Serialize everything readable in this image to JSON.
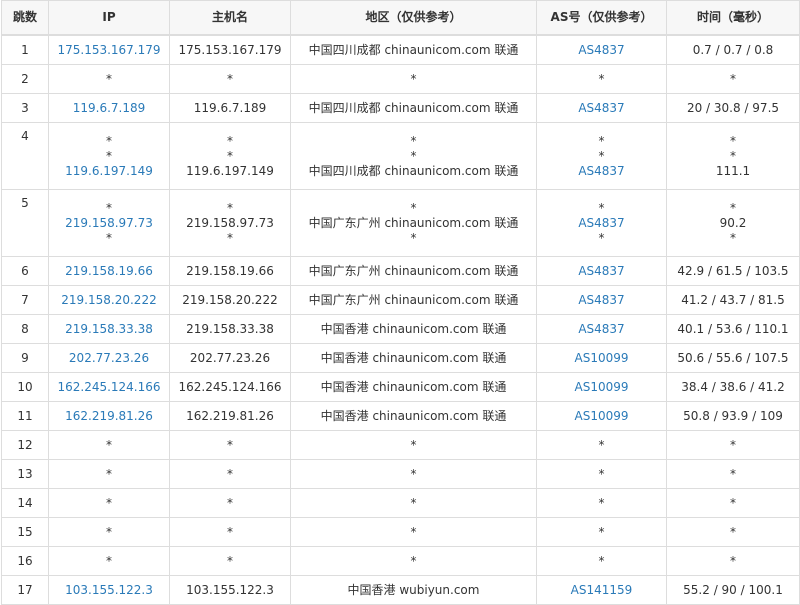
{
  "columns": [
    "跳数",
    "IP",
    "主机名",
    "地区（仅供参考）",
    "AS号（仅供参考）",
    "时间（毫秒）"
  ],
  "accent_link_color": "#2a7ab8",
  "rows": [
    {
      "hop": "1",
      "lines": [
        {
          "ip": "175.153.167.179",
          "host": "175.153.167.179",
          "region": "中国四川成都 chinaunicom.com 联通",
          "asn": "AS4837",
          "time": "0.7 / 0.7 / 0.8"
        }
      ]
    },
    {
      "hop": "2",
      "lines": [
        {
          "ip": "*",
          "host": "*",
          "region": "*",
          "asn": "*",
          "time": "*"
        }
      ]
    },
    {
      "hop": "3",
      "lines": [
        {
          "ip": "119.6.7.189",
          "host": "119.6.7.189",
          "region": "中国四川成都 chinaunicom.com 联通",
          "asn": "AS4837",
          "time": "20 / 30.8 / 97.5"
        }
      ]
    },
    {
      "hop": "4",
      "lines": [
        {
          "ip": "*",
          "host": "*",
          "region": "*",
          "asn": "*",
          "time": "*"
        },
        {
          "ip": "*",
          "host": "*",
          "region": "*",
          "asn": "*",
          "time": "*"
        },
        {
          "ip": "119.6.197.149",
          "host": "119.6.197.149",
          "region": "中国四川成都 chinaunicom.com 联通",
          "asn": "AS4837",
          "time": "111.1"
        }
      ]
    },
    {
      "hop": "5",
      "lines": [
        {
          "ip": "*",
          "host": "*",
          "region": "*",
          "asn": "*",
          "time": "*"
        },
        {
          "ip": "219.158.97.73",
          "host": "219.158.97.73",
          "region": "中国广东广州 chinaunicom.com 联通",
          "asn": "AS4837",
          "time": "90.2"
        },
        {
          "ip": "*",
          "host": "*",
          "region": "*",
          "asn": "*",
          "time": "*"
        }
      ]
    },
    {
      "hop": "6",
      "lines": [
        {
          "ip": "219.158.19.66",
          "host": "219.158.19.66",
          "region": "中国广东广州 chinaunicom.com 联通",
          "asn": "AS4837",
          "time": "42.9 / 61.5 / 103.5"
        }
      ]
    },
    {
      "hop": "7",
      "lines": [
        {
          "ip": "219.158.20.222",
          "host": "219.158.20.222",
          "region": "中国广东广州 chinaunicom.com 联通",
          "asn": "AS4837",
          "time": "41.2 / 43.7 / 81.5"
        }
      ]
    },
    {
      "hop": "8",
      "lines": [
        {
          "ip": "219.158.33.38",
          "host": "219.158.33.38",
          "region": "中国香港 chinaunicom.com 联通",
          "asn": "AS4837",
          "time": "40.1 / 53.6 / 110.1"
        }
      ]
    },
    {
      "hop": "9",
      "lines": [
        {
          "ip": "202.77.23.26",
          "host": "202.77.23.26",
          "region": "中国香港 chinaunicom.com 联通",
          "asn": "AS10099",
          "time": "50.6 / 55.6 / 107.5"
        }
      ]
    },
    {
      "hop": "10",
      "lines": [
        {
          "ip": "162.245.124.166",
          "host": "162.245.124.166",
          "region": "中国香港 chinaunicom.com 联通",
          "asn": "AS10099",
          "time": "38.4 / 38.6 / 41.2"
        }
      ]
    },
    {
      "hop": "11",
      "lines": [
        {
          "ip": "162.219.81.26",
          "host": "162.219.81.26",
          "region": "中国香港 chinaunicom.com 联通",
          "asn": "AS10099",
          "time": "50.8 / 93.9 / 109"
        }
      ]
    },
    {
      "hop": "12",
      "lines": [
        {
          "ip": "*",
          "host": "*",
          "region": "*",
          "asn": "*",
          "time": "*"
        }
      ]
    },
    {
      "hop": "13",
      "lines": [
        {
          "ip": "*",
          "host": "*",
          "region": "*",
          "asn": "*",
          "time": "*"
        }
      ]
    },
    {
      "hop": "14",
      "lines": [
        {
          "ip": "*",
          "host": "*",
          "region": "*",
          "asn": "*",
          "time": "*"
        }
      ]
    },
    {
      "hop": "15",
      "lines": [
        {
          "ip": "*",
          "host": "*",
          "region": "*",
          "asn": "*",
          "time": "*"
        }
      ]
    },
    {
      "hop": "16",
      "lines": [
        {
          "ip": "*",
          "host": "*",
          "region": "*",
          "asn": "*",
          "time": "*"
        }
      ]
    },
    {
      "hop": "17",
      "lines": [
        {
          "ip": "103.155.122.3",
          "host": "103.155.122.3",
          "region": "中国香港 wubiyun.com",
          "asn": "AS141159",
          "time": "55.2 / 90 / 100.1"
        }
      ]
    }
  ]
}
